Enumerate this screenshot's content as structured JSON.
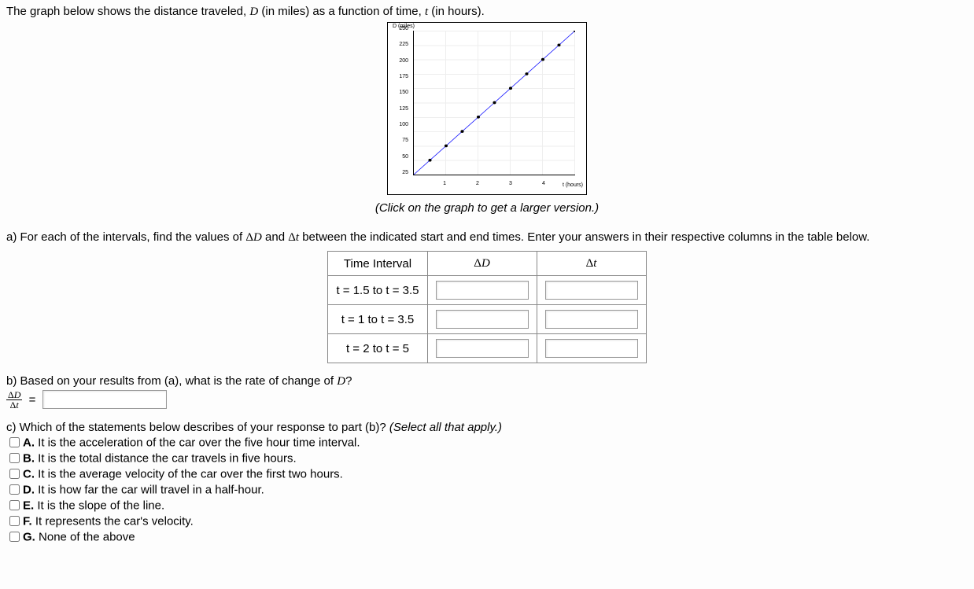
{
  "intro": "The graph below shows the distance traveled, D (in miles) as a function of time, t (in hours).",
  "chart_data": {
    "type": "line",
    "xlabel": "t (hours)",
    "ylabel": "D (miles)",
    "xlim": [
      0,
      5
    ],
    "ylim": [
      0,
      250
    ],
    "x_ticks": [
      "",
      "1",
      "2",
      "3",
      "4",
      ""
    ],
    "y_ticks": [
      "25",
      "50",
      "75",
      "100",
      "125",
      "150",
      "175",
      "200",
      "225",
      "250"
    ],
    "series": [
      {
        "name": "D",
        "x": [
          0,
          0.5,
          1,
          1.5,
          2,
          2.5,
          3,
          3.5,
          4,
          4.5,
          5
        ],
        "y": [
          0,
          25,
          50,
          75,
          100,
          125,
          150,
          175,
          200,
          225,
          250
        ]
      }
    ]
  },
  "caption": "(Click on the graph to get a larger version.)",
  "partA": {
    "prompt": "a) For each of the intervals, find the values of ΔD and Δt between the indicated start and end times. Enter your answers in their respective columns in the table below.",
    "headers": {
      "col1": "Time Interval",
      "col2": "ΔD",
      "col3": "Δt"
    },
    "rows": [
      {
        "label": "t = 1.5 to t = 3.5"
      },
      {
        "label": "t = 1 to t = 3.5"
      },
      {
        "label": "t = 2 to t = 5"
      }
    ]
  },
  "partB": {
    "prompt": "b) Based on your results from (a), what is the rate of change of D?",
    "frac_top": "ΔD",
    "frac_bot": "Δt",
    "equals": "="
  },
  "partC": {
    "prompt_pre": "c) Which of the statements below describes of your response to part (b)? ",
    "prompt_ital": "(Select all that apply.)",
    "options": [
      {
        "letter": "A.",
        "text": "It is the acceleration of the car over the five hour time interval."
      },
      {
        "letter": "B.",
        "text": "It is the total distance the car travels in five hours."
      },
      {
        "letter": "C.",
        "text": "It is the average velocity of the car over the first two hours."
      },
      {
        "letter": "D.",
        "text": "It is how far the car will travel in a half-hour."
      },
      {
        "letter": "E.",
        "text": "It is the slope of the line."
      },
      {
        "letter": "F.",
        "text": "It represents the car's velocity."
      },
      {
        "letter": "G.",
        "text": "None of the above"
      }
    ]
  }
}
